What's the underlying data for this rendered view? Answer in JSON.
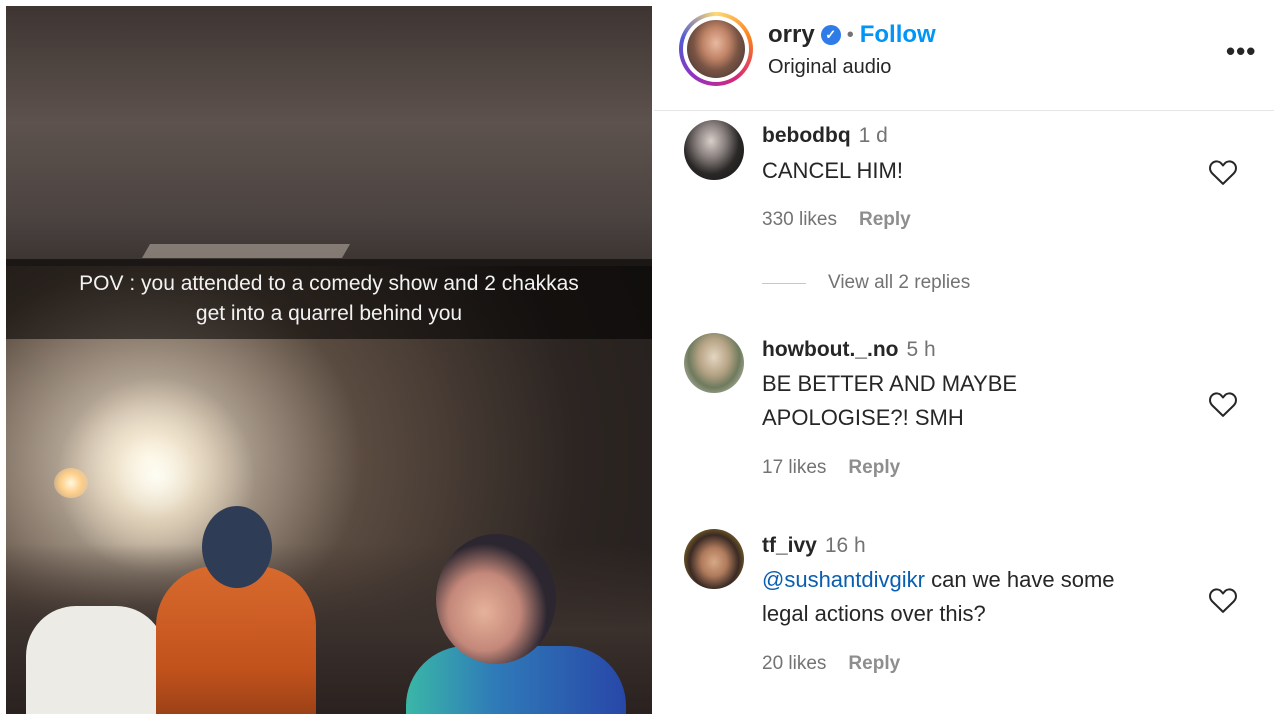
{
  "media": {
    "caption_line1": "POV : you attended to a comedy show and 2 chakkas",
    "caption_line2": "get into a quarrel behind you"
  },
  "post_header": {
    "username": "orry",
    "verified": true,
    "separator": "•",
    "follow_label": "Follow",
    "audio_label": "Original audio",
    "more_icon": "more-options-icon",
    "more_glyph": "•••"
  },
  "comments": [
    {
      "username": "bebodbq",
      "time": "1 d",
      "text": "CANCEL HIM!",
      "likes": "330 likes",
      "reply_label": "Reply",
      "view_replies": "View all 2 replies"
    },
    {
      "username": "howbout._.no",
      "time": "5 h",
      "text_line1": "BE BETTER AND MAYBE",
      "text_line2": "APOLOGISE?! SMH",
      "likes": "17 likes",
      "reply_label": "Reply"
    },
    {
      "username": "tf_ivy",
      "time": "16 h",
      "mention": "@sushantdivgikr",
      "text_rest": " can we have some",
      "text_line2": "legal actions over this?",
      "likes": "20 likes",
      "reply_label": "Reply"
    }
  ],
  "icons": {
    "heart": "heart-outline-icon",
    "verified": "verified-badge-icon",
    "verified_glyph": "✓"
  },
  "colors": {
    "follow_blue": "#0095f6",
    "mention_blue": "#0a5eb0",
    "verified_blue": "#2f7be8",
    "muted_text": "#737373"
  }
}
